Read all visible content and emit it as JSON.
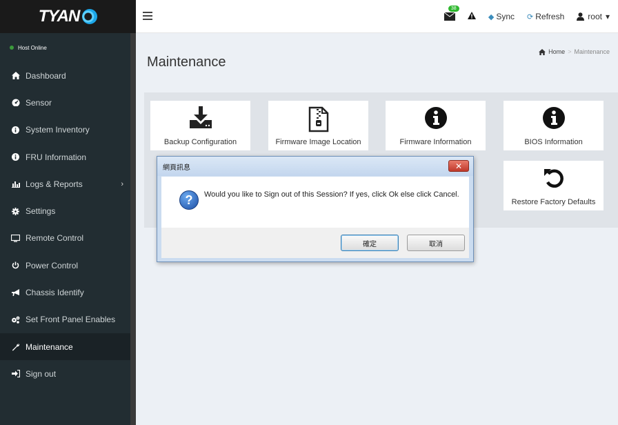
{
  "brand": {
    "logo_text": "TYAN"
  },
  "status": {
    "label": "Host Online",
    "color": "#3c9a3c"
  },
  "sidebar": {
    "items": [
      {
        "label": "Dashboard",
        "icon": "home-icon"
      },
      {
        "label": "Sensor",
        "icon": "gauge-icon"
      },
      {
        "label": "System Inventory",
        "icon": "info-icon"
      },
      {
        "label": "FRU Information",
        "icon": "info-icon"
      },
      {
        "label": "Logs & Reports",
        "icon": "bar-chart-icon"
      },
      {
        "label": "Settings",
        "icon": "gear-icon"
      },
      {
        "label": "Remote Control",
        "icon": "monitor-icon"
      },
      {
        "label": "Power Control",
        "icon": "power-icon"
      },
      {
        "label": "Chassis Identify",
        "icon": "bullhorn-icon"
      },
      {
        "label": "Set Front Panel Enables",
        "icon": "gears-icon"
      },
      {
        "label": "Maintenance",
        "icon": "wrench-icon"
      },
      {
        "label": "Sign out",
        "icon": "sign-out-icon"
      }
    ],
    "active_index": 10
  },
  "header": {
    "notification_count": "38",
    "sync_label": "Sync",
    "refresh_label": "Refresh",
    "user_label": "root"
  },
  "page": {
    "title": "Maintenance",
    "breadcrumb_home": "Home",
    "breadcrumb_current": "Maintenance"
  },
  "tiles": [
    {
      "label": "Backup Configuration",
      "icon": "download-icon"
    },
    {
      "label": "Firmware Image Location",
      "icon": "zip-file-icon"
    },
    {
      "label": "Firmware Information",
      "icon": "info-circle-icon"
    },
    {
      "label": "BIOS Information",
      "icon": "info-circle-icon"
    },
    {
      "label": "Restore Factory Defaults",
      "icon": "undo-icon"
    }
  ],
  "dialog": {
    "title": "網頁訊息",
    "message": "Would you like to Sign out of this Session? If yes, click Ok else click Cancel.",
    "ok_label": "確定",
    "cancel_label": "取消"
  },
  "colors": {
    "sidebar_bg": "#222d32",
    "accent": "#3c8dbc",
    "badge": "#2eb82e"
  }
}
